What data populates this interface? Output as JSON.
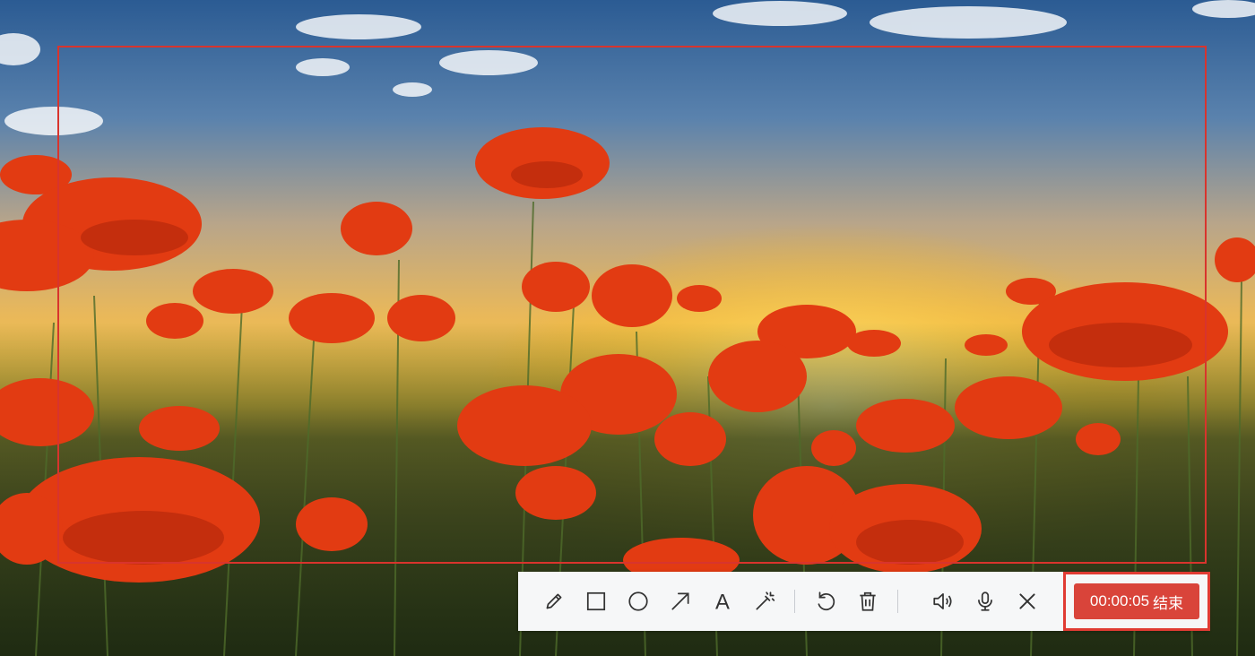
{
  "toolbar": {
    "tools": [
      {
        "icon": "pencil-icon",
        "label": ""
      },
      {
        "icon": "rectangle-icon",
        "label": ""
      },
      {
        "icon": "circle-icon",
        "label": ""
      },
      {
        "icon": "arrow-icon",
        "label": ""
      },
      {
        "icon": "text-icon",
        "label": "A"
      },
      {
        "icon": "magic-wand-icon",
        "label": ""
      },
      {
        "icon": "undo-icon",
        "label": ""
      },
      {
        "icon": "trash-icon",
        "label": ""
      },
      {
        "icon": "speaker-icon",
        "label": ""
      },
      {
        "icon": "microphone-icon",
        "label": ""
      },
      {
        "icon": "close-icon",
        "label": ""
      }
    ],
    "icon_color": "#333333"
  },
  "recording": {
    "timer": "00:00:05",
    "stop_label": "结束",
    "button_color": "#d9443a",
    "highlight_color": "#e03b33"
  },
  "frame": {
    "color": "#d8342d"
  }
}
